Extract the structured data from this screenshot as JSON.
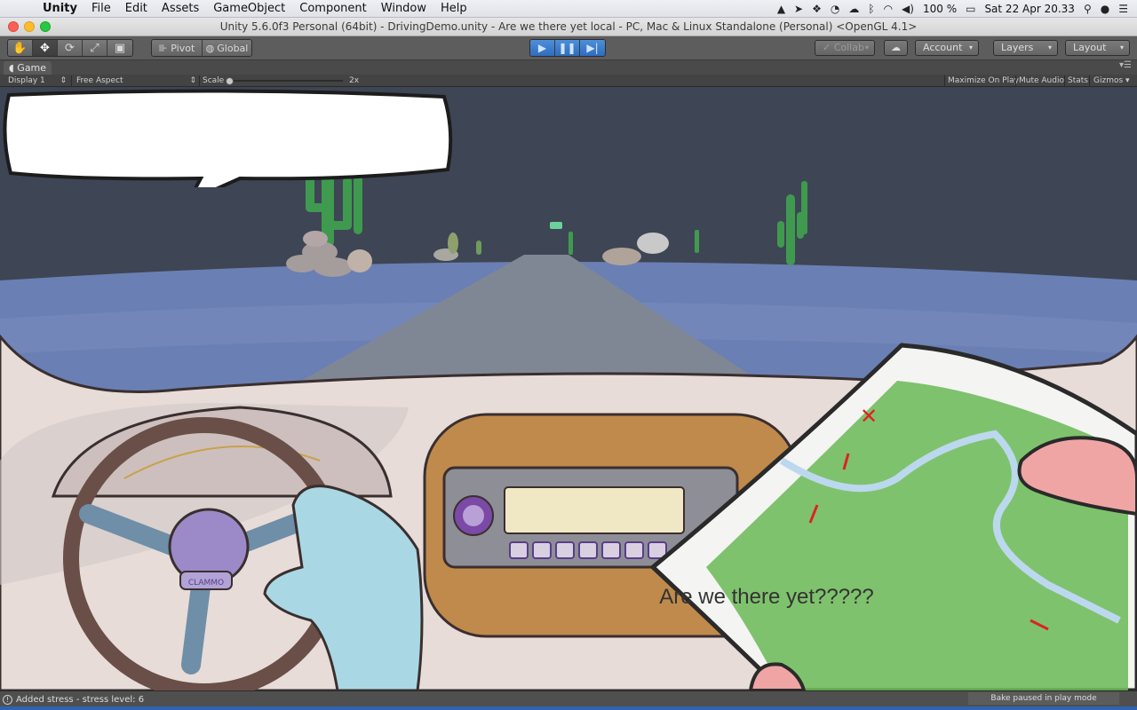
{
  "menubar": {
    "app_name": "Unity",
    "items": [
      "File",
      "Edit",
      "Assets",
      "GameObject",
      "Component",
      "Window",
      "Help"
    ],
    "battery": "100 %",
    "datetime": "Sat 22 Apr  20.33"
  },
  "window": {
    "title": "Unity 5.6.0f3 Personal (64bit) - DrivingDemo.unity - Are we there yet local - PC, Mac & Linux Standalone (Personal) <OpenGL 4.1>"
  },
  "toolbar": {
    "pivot_label": "Pivot",
    "global_label": "Global",
    "collab_label": "Collab",
    "account_label": "Account",
    "layers_label": "Layers",
    "layout_label": "Layout"
  },
  "game_view": {
    "tab_label": "Game",
    "display_label": "Display 1",
    "aspect_label": "Free Aspect",
    "scale_label": "Scale",
    "scale_value": "2x",
    "maximize_label": "Maximize On Play",
    "mute_label": "Mute Audio",
    "stats_label": "Stats",
    "gizmos_label": "Gizmos"
  },
  "game": {
    "speech_text": "Are we there yet?????",
    "brand_text": "CLAMMO",
    "stress_level_fraction": 0.0
  },
  "status": {
    "message": "Added stress - stress level: 6",
    "bake": "Bake paused in play mode"
  },
  "colors": {
    "sky": "#3e4554",
    "ground": "#6a7fb4",
    "road": "#7f8794",
    "dashboard": "#e7dcd8",
    "map_green": "#6ab856",
    "accent_play": "#2e6cc0"
  }
}
